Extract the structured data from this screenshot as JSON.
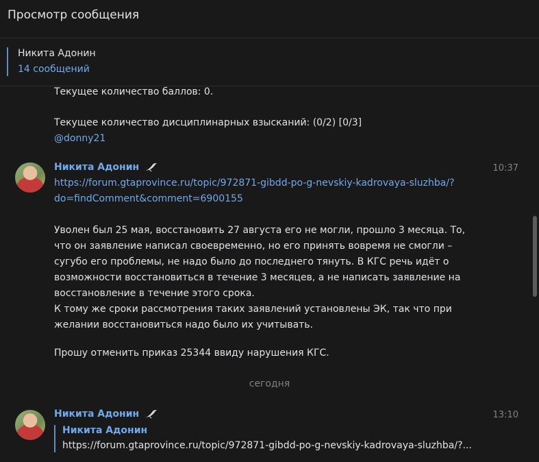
{
  "header": {
    "title": "Просмотр сообщения"
  },
  "chat_info": {
    "name": "Никита Адонин",
    "count": "14 сообщений"
  },
  "prev_message": {
    "lines": [
      "Текущее количество баллов: 0.",
      "",
      "Текущее количество дисциплинарных взысканий: (0/2) [0/3]"
    ],
    "mention": "@donny21"
  },
  "message1": {
    "author": "Никита Адонин",
    "time": "10:37",
    "link_line1": "https://forum.gtaprovince.ru/topic/972871-gibdd-po-g-nevskiy-kadrovaya-sluzhba/?",
    "link_line2": "do=findComment&comment=6900155",
    "body": [
      "Уволен был 25 мая, восстановить 27 августа его не могли, прошло 3 месяца. То,",
      "что он заявление написал своевременно, но его принять вовремя не смогли –",
      "сугубо его проблемы, не надо было до последнего тянуть. В КГС речь идёт о",
      "возможности восстановиться в течение 3 месяцев, а не написать заявление на",
      "восстановление в течение этого срока.",
      "К тому же сроки рассмотрения таких заявлений установлены ЭК, так что при",
      "желании восстановиться надо было их учитывать."
    ],
    "closing": "Прошу отменить приказ 25344 ввиду нарушения КГС."
  },
  "date_separator": "сегодня",
  "message2": {
    "author": "Никита Адонин",
    "time": "13:10",
    "quote_author": "Никита Адонин",
    "quote_text": "https://forum.gtaprovince.ru/topic/972871-gibdd-po-g-nevskiy-kadrovaya-sluzhba/?..."
  },
  "icons": {
    "author_badge": "bird-icon",
    "avatar": "avatar-photo"
  }
}
